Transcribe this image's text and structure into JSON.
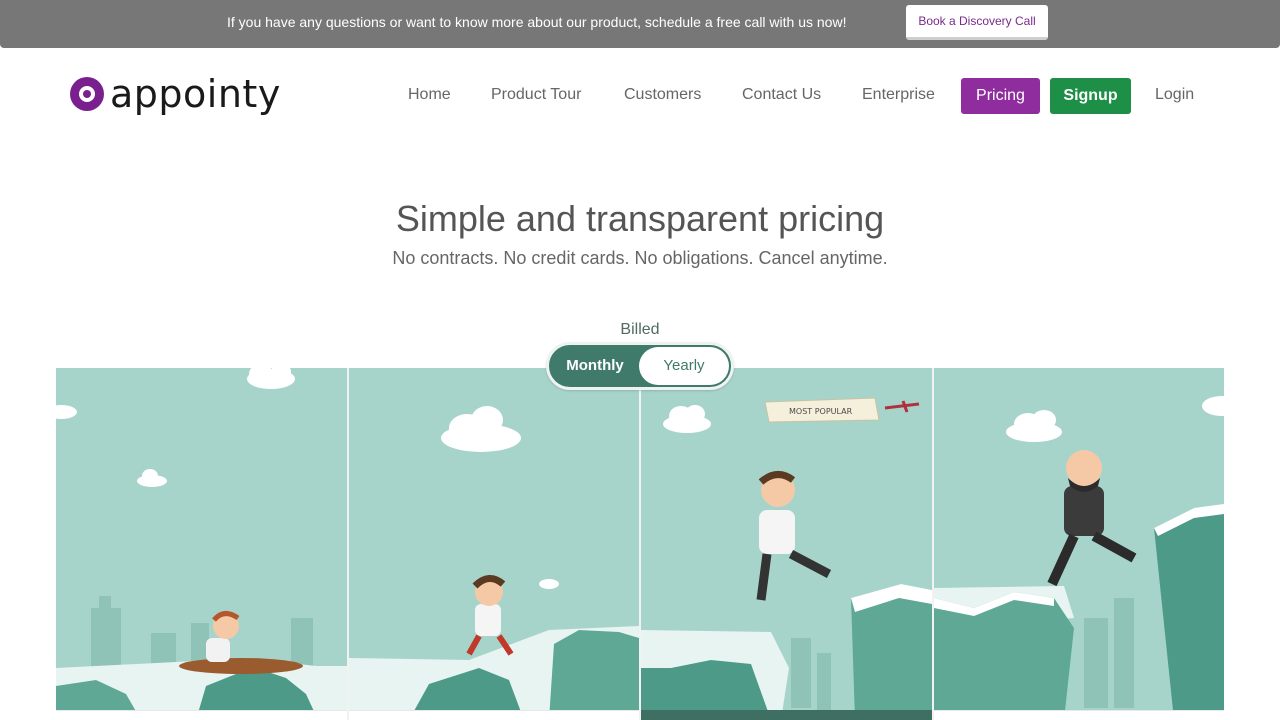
{
  "topbar": {
    "message": "If you have any questions or want to know more about our product, schedule a free call with us now!",
    "cta_label": "Book a Discovery Call"
  },
  "logo": {
    "text": "appointy"
  },
  "nav": {
    "items": [
      "Home",
      "Product Tour",
      "Customers",
      "Contact Us",
      "Enterprise"
    ],
    "pricing_label": "Pricing",
    "signup_label": "Signup",
    "login_label": "Login"
  },
  "hero": {
    "title": "Simple and transparent pricing",
    "subtitle": "No contracts. No credit cards. No obligations. Cancel anytime."
  },
  "billing": {
    "label": "Billed",
    "options": [
      "Monthly",
      "Yearly"
    ],
    "selected": "Yearly"
  },
  "plans_banner": {
    "popular_text": "MOST POPULAR"
  },
  "colors": {
    "brand_purple": "#8f2d9e",
    "signup_green": "#1d8f46",
    "panel_teal": "#a7d4ca",
    "toggle_teal": "#3f7a6b",
    "topbar_gray": "#777777"
  }
}
